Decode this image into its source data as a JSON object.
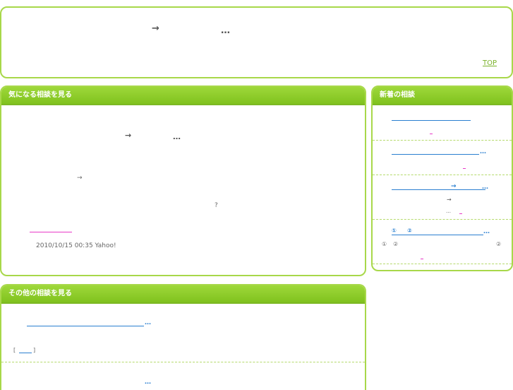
{
  "header": {
    "arrow": "→",
    "ellipsis": "…",
    "top_link": "TOP"
  },
  "main_panel": {
    "title": "気になる相談を見る",
    "arrow1": "→",
    "ellipsis1": "…",
    "arrow2": "→",
    "question": "?",
    "timestamp": "2010/10/15 00:35 Yahoo!"
  },
  "side_panel": {
    "title": "新着の相談",
    "items": [
      {
        "ellipsis": ""
      },
      {
        "ellipsis": "…"
      },
      {
        "arrow": "→",
        "ellipsis": "…",
        "sub_arrow": "→",
        "sub_dots": "…"
      },
      {
        "num1": "①",
        "num2": "②",
        "ellipsis": "…",
        "sub1": "①",
        "sub2": "②",
        "sub3": "②"
      }
    ]
  },
  "other_panel": {
    "title": "その他の相談を見る",
    "items": [
      {
        "ellipsis": "…",
        "bracket_open": "[",
        "bracket_close": "]"
      },
      {
        "ellipsis": "…"
      }
    ]
  },
  "colors": {
    "accent_green": "#8fcc2a",
    "link_blue": "#2a7fd0",
    "pink": "#e83ac8"
  }
}
